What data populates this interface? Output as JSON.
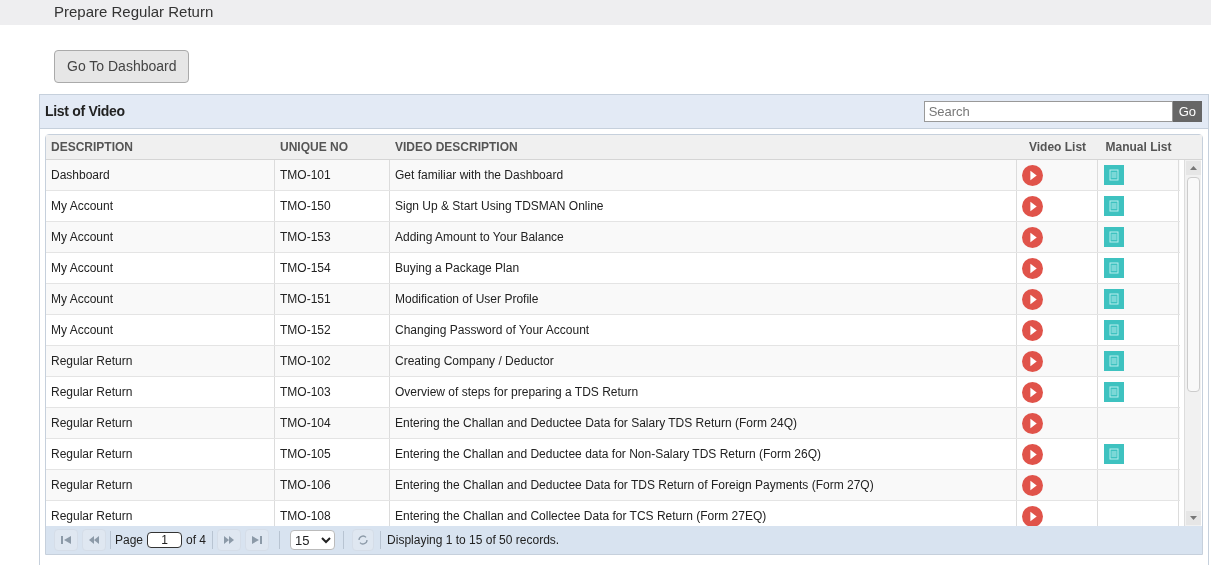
{
  "page_title": "Prepare Regular Return",
  "dashboard_button": "Go To Dashboard",
  "panel": {
    "title": "List of Video",
    "search": {
      "placeholder": "Search"
    },
    "go_button": "Go"
  },
  "table": {
    "columns": [
      "DESCRIPTION",
      "UNIQUE NO",
      "VIDEO DESCRIPTION",
      "Video List",
      "Manual List"
    ],
    "rows": [
      {
        "description": "Dashboard",
        "unique_no": "TMO-101",
        "video_description": "Get familiar with the Dashboard",
        "manual": true
      },
      {
        "description": "My Account",
        "unique_no": "TMO-150",
        "video_description": "Sign Up & Start Using TDSMAN Online",
        "manual": true
      },
      {
        "description": "My Account",
        "unique_no": "TMO-153",
        "video_description": "Adding Amount to Your Balance",
        "manual": true
      },
      {
        "description": "My Account",
        "unique_no": "TMO-154",
        "video_description": "Buying a Package Plan",
        "manual": true
      },
      {
        "description": "My Account",
        "unique_no": "TMO-151",
        "video_description": "Modification of User Profile",
        "manual": true
      },
      {
        "description": "My Account",
        "unique_no": "TMO-152",
        "video_description": "Changing Password of Your Account",
        "manual": true
      },
      {
        "description": "Regular Return",
        "unique_no": "TMO-102",
        "video_description": "Creating Company / Deductor",
        "manual": true
      },
      {
        "description": "Regular Return",
        "unique_no": "TMO-103",
        "video_description": "Overview of steps for preparing a TDS Return",
        "manual": true
      },
      {
        "description": "Regular Return",
        "unique_no": "TMO-104",
        "video_description": "Entering the Challan and Deductee Data for Salary TDS Return (Form 24Q)",
        "manual": false
      },
      {
        "description": "Regular Return",
        "unique_no": "TMO-105",
        "video_description": "Entering the Challan and Deductee data for Non-Salary TDS Return (Form 26Q)",
        "manual": true
      },
      {
        "description": "Regular Return",
        "unique_no": "TMO-106",
        "video_description": "Entering the Challan and Deductee Data for TDS Return of Foreign Payments (Form 27Q)",
        "manual": false
      },
      {
        "description": "Regular Return",
        "unique_no": "TMO-108",
        "video_description": "Entering the Challan and Collectee Data for TCS Return (Form 27EQ)",
        "manual": false
      }
    ]
  },
  "pager": {
    "page_label": "Page",
    "page_value": "1",
    "of_label": "of 4",
    "page_size": "15",
    "summary": "Displaying 1 to 15 of 50 records."
  }
}
